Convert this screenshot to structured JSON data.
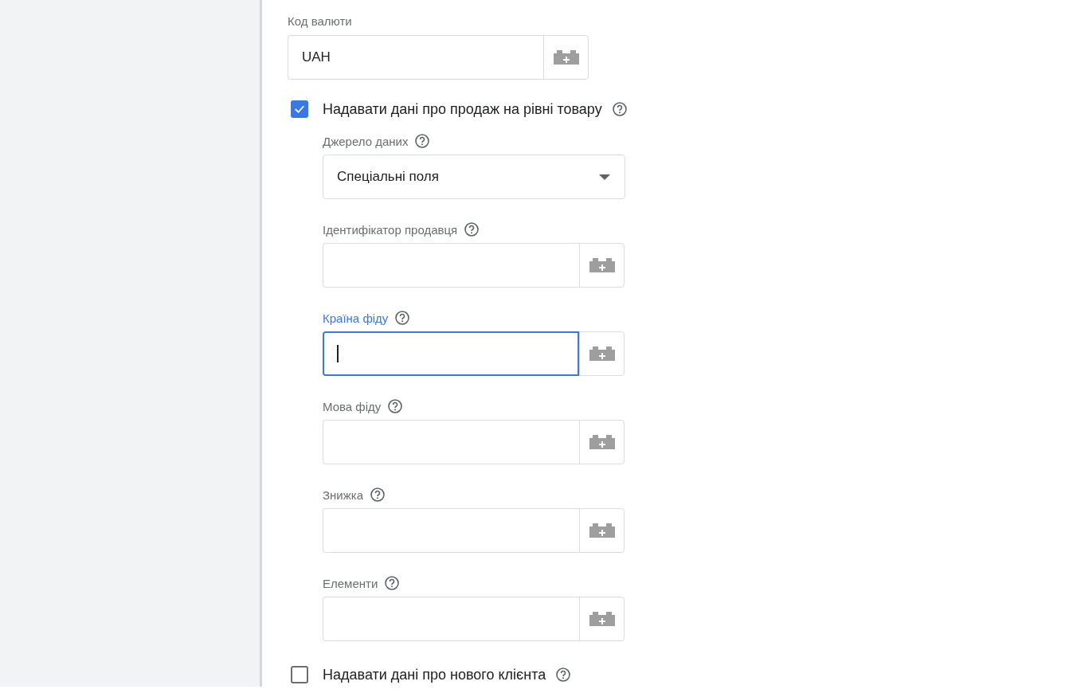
{
  "currency_field": {
    "label": "Код валюти",
    "value": "UAH"
  },
  "product_sales": {
    "label": "Надавати дані про продаж на рівні товару",
    "checked": true,
    "data_source": {
      "label": "Джерело даних",
      "value": "Спеціальні поля"
    },
    "fields": [
      {
        "label": "Ідентифікатор продавця",
        "focused": false
      },
      {
        "label": "Країна фіду",
        "focused": true
      },
      {
        "label": "Мова фіду",
        "focused": false
      },
      {
        "label": "Знижка",
        "focused": false
      },
      {
        "label": "Елементи",
        "focused": false
      }
    ]
  },
  "new_customer": {
    "label": "Надавати дані про нового клієнта",
    "checked": false
  }
}
